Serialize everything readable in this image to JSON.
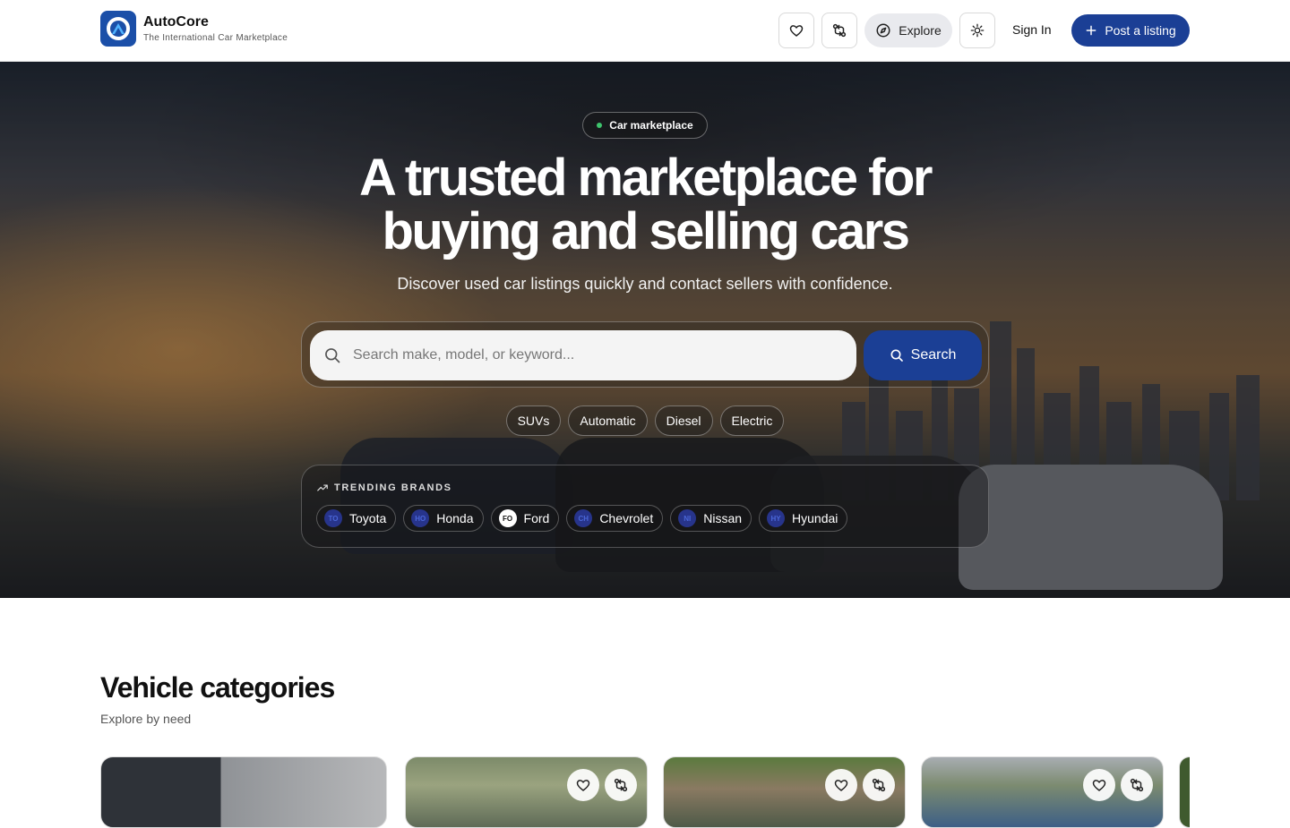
{
  "header": {
    "brand_name": "AutoCore",
    "brand_tagline": "The International Car Marketplace",
    "explore_label": "Explore",
    "sign_in_label": "Sign In",
    "post_listing_label": "Post a listing",
    "icons": [
      "heart-icon",
      "compare-icon",
      "compass-icon",
      "sun-icon",
      "plus-icon"
    ]
  },
  "hero": {
    "badge": "Car marketplace",
    "title_line1": "A trusted marketplace for",
    "title_line2": "buying and selling cars",
    "subtitle": "Discover used car listings quickly and contact sellers with confidence.",
    "search_placeholder": "Search make, model, or keyword...",
    "search_button": "Search",
    "quick_filters": [
      "SUVs",
      "Automatic",
      "Diesel",
      "Electric"
    ],
    "trending_title": "TRENDING BRANDS",
    "brands": [
      {
        "name": "Toyota",
        "abbr": "TO"
      },
      {
        "name": "Honda",
        "abbr": "HO"
      },
      {
        "name": "Ford",
        "abbr": "FO"
      },
      {
        "name": "Chevrolet",
        "abbr": "CH"
      },
      {
        "name": "Nissan",
        "abbr": "NI"
      },
      {
        "name": "Hyundai",
        "abbr": "HY"
      }
    ]
  },
  "categories": {
    "title": "Vehicle categories",
    "subtitle": "Explore by need"
  },
  "colors": {
    "accent": "#1b3f95",
    "logo_bg": "#1b4fa8",
    "badge_dot": "#3ec46d"
  }
}
